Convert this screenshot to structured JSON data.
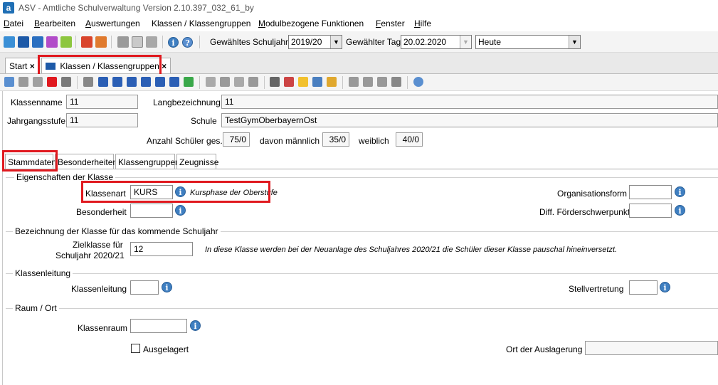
{
  "window": {
    "title": "ASV - Amtliche Schulverwaltung Version 2.10.397_032_61_by",
    "app_icon": "a"
  },
  "menu": [
    {
      "mnemonic": "D",
      "rest": "atei"
    },
    {
      "mnemonic": "B",
      "rest": "earbeiten"
    },
    {
      "mnemonic": "A",
      "rest": "uswertungen"
    },
    {
      "mnemonic": "",
      "rest": "Klassen / Klassengruppen"
    },
    {
      "mnemonic": "M",
      "rest": "odulbezogene Funktionen"
    },
    {
      "mnemonic": "F",
      "rest": "enster"
    },
    {
      "mnemonic": "H",
      "rest": "ilfe"
    }
  ],
  "toolbar": {
    "schuljahr_label": "Gewähltes Schuljahr",
    "schuljahr_value": "2019/20",
    "tag_label": "Gewählter Tag",
    "tag_value": "20.02.2020",
    "heute_value": "Heute"
  },
  "tabs": {
    "start_label": "Start",
    "klassen_label": "Klassen / Klassengruppen",
    "close_glyph": "×"
  },
  "header": {
    "klassenname_label": "Klassenname",
    "klassenname_value": "11",
    "langbezeichnung_label": "Langbezeichnung",
    "langbezeichnung_value": "11",
    "jahrgangsstufe_label": "Jahrgangsstufe",
    "jahrgangsstufe_value": "11",
    "schule_label": "Schule",
    "schule_value": "TestGymOberbayernOst",
    "anzahl_label": "Anzahl Schüler ges.",
    "anzahl_value": "75/0",
    "maennlich_label": "davon männlich",
    "maennlich_value": "35/0",
    "weiblich_label": "weiblich",
    "weiblich_value": "40/0"
  },
  "subtabs": [
    "Stammdaten",
    "Besonderheiten",
    "Klassengruppen",
    "Zeugnisse"
  ],
  "eigenschaften": {
    "section_title": "Eigenschaften der Klasse",
    "klassenart_label": "Klassenart",
    "klassenart_value": "KURS",
    "klassenart_hint": "Kursphase der Oberstufe",
    "besonderheit_label": "Besonderheit",
    "besonderheit_value": "",
    "organisationsform_label": "Organisationsform",
    "organisationsform_value": "",
    "foerder_label": "Diff. Förderschwerpunkt",
    "foerder_value": ""
  },
  "bezeichnung": {
    "section_title": "Bezeichnung der Klasse für das kommende Schuljahr",
    "zielklasse_label_1": "Zielklasse für",
    "zielklasse_label_2": "Schuljahr 2020/21",
    "zielklasse_value": "12",
    "hint": "In diese Klasse werden bei der Neuanlage des Schuljahres 2020/21 die Schüler dieser Klasse pauschal hineinversetzt."
  },
  "klassenleitung": {
    "section_title": "Klassenleitung",
    "klassenleitung_label": "Klassenleitung",
    "klassenleitung_value": "",
    "stellvertretung_label": "Stellvertretung",
    "stellvertretung_value": ""
  },
  "raum": {
    "section_title": "Raum / Ort",
    "klassenraum_label": "Klassenraum",
    "klassenraum_value": "",
    "ausgelagert_label": "Ausgelagert",
    "auslagerung_label": "Ort der Auslagerung",
    "auslagerung_value": ""
  },
  "icons": {
    "info_glyph": "i",
    "dropdown_glyph": "▼",
    "highlight_color": "#e0191f"
  }
}
